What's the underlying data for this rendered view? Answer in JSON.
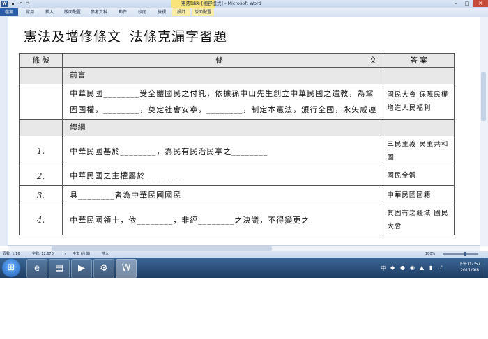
{
  "window": {
    "title": "憲法.doc [相容模式] - Microsoft Word",
    "contextual_tab_group": "表格工具",
    "icons": [
      "word-icon",
      "save-icon",
      "undo-icon",
      "redo-icon",
      "minimize-icon",
      "maximize-icon",
      "close-icon"
    ]
  },
  "ribbon": {
    "tabs": [
      "檔案",
      "常用",
      "插入",
      "版面配置",
      "參考資料",
      "郵件",
      "校閱",
      "檢視",
      "設計",
      "版面配置"
    ]
  },
  "document": {
    "title_part1": "憲法及增修條文",
    "title_part2": "法條克漏字習題",
    "table": {
      "headers": [
        "條 號",
        "條",
        "文",
        "答 案"
      ],
      "rows": [
        {
          "type": "section",
          "no": "",
          "text": "前言",
          "answer": ""
        },
        {
          "type": "item",
          "no": "",
          "text": "中華民國________受全體國民之付託，依據孫中山先生創立中華民國之遺教，為鞏固國權，________，奠定社會安寧，________，制定本憲法，頒行全國，永矢咸遵",
          "answer": "國民大會 保障民權 增進人民福利"
        },
        {
          "type": "section",
          "no": "",
          "text": "總綱",
          "answer": ""
        },
        {
          "type": "item",
          "no": "1.",
          "text": "中華民國基於________，為民有民治民享之________",
          "answer": "三民主義 民主共和國"
        },
        {
          "type": "item",
          "no": "2.",
          "text": "中華民國之主權屬於________",
          "answer": "國民全體"
        },
        {
          "type": "item",
          "no": "3.",
          "text": "具________者為中華民國國民",
          "answer": "中華民國國籍"
        },
        {
          "type": "item",
          "no": "4.",
          "text": "中華民國領土，依________，非經________之決議，不得變更之",
          "answer": "其固有之疆域 國民大會"
        }
      ]
    }
  },
  "statusbar": {
    "page": "頁數: 1/16",
    "words": "字數: 12,676",
    "language": "中文 (台灣)",
    "mode": "插入",
    "zoom": "180%"
  },
  "taskbar": {
    "time": "下午 07:57",
    "date": "2011/9/8",
    "items": [
      "windows-start-icon",
      "ie-icon",
      "explorer-icon",
      "media-player-icon",
      "network-tool-icon",
      "word-taskbar-icon"
    ]
  }
}
